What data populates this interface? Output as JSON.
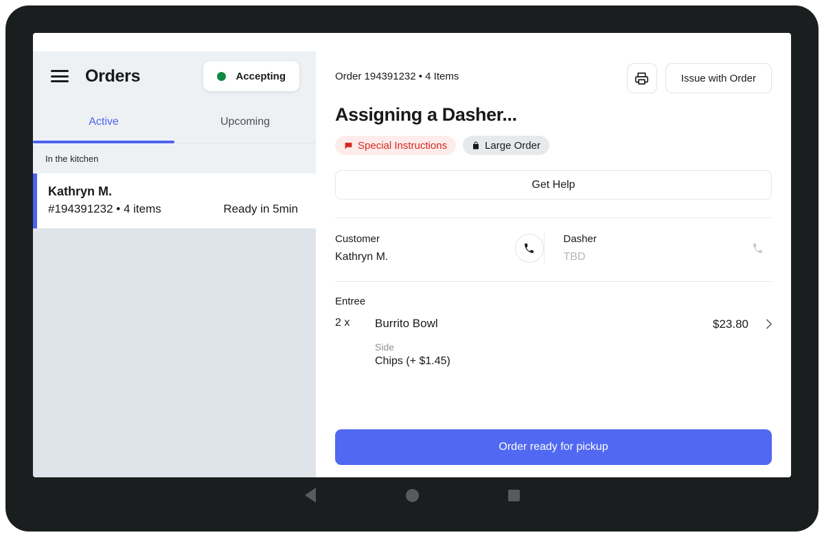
{
  "sidebar": {
    "menu_icon": "hamburger-icon",
    "title": "Orders",
    "store_status": {
      "label": "Accepting",
      "dot_color": "#0f8a43"
    },
    "tabs": [
      {
        "label": "Active",
        "active": true
      },
      {
        "label": "Upcoming",
        "active": false
      }
    ],
    "section_label": "In the kitchen",
    "orders": [
      {
        "customer_name": "Kathryn M.",
        "meta": "#194391232 • 4 items",
        "eta": "Ready in 5min",
        "selected": true,
        "accent_color": "#4c62f0"
      }
    ]
  },
  "main": {
    "order_meta": "Order 194391232 • 4 Items",
    "print_icon": "printer-icon",
    "issue_button": "Issue with Order",
    "status_title": "Assigning a Dasher...",
    "badges": [
      {
        "label": "Special Instructions",
        "icon": "speech-bubble-icon",
        "color": "#d4291f",
        "background": "#fdecea"
      },
      {
        "label": "Large Order",
        "icon": "bag-icon",
        "color": "#191919",
        "background": "#e7e9ec"
      }
    ],
    "get_help_button": "Get Help",
    "contacts": [
      {
        "role": "Customer",
        "name": "Kathryn M.",
        "call_icon": "phone-icon",
        "call_enabled": true
      },
      {
        "role": "Dasher",
        "name": "TBD",
        "call_icon": "phone-icon",
        "call_enabled": false
      }
    ],
    "items_section_label": "Entree",
    "items": [
      {
        "quantity": "2 x",
        "name": "Burrito Bowl",
        "price": "$23.80",
        "chevron": "chevron-right-icon",
        "options": [
          {
            "group": "Side",
            "value": "Chips (+ $1.45)"
          }
        ]
      }
    ],
    "primary_action": "Order ready for pickup",
    "primary_action_color": "#5068f2"
  },
  "android_nav": {
    "back": "back-triangle-icon",
    "home": "home-circle-icon",
    "recents": "recents-square-icon"
  }
}
